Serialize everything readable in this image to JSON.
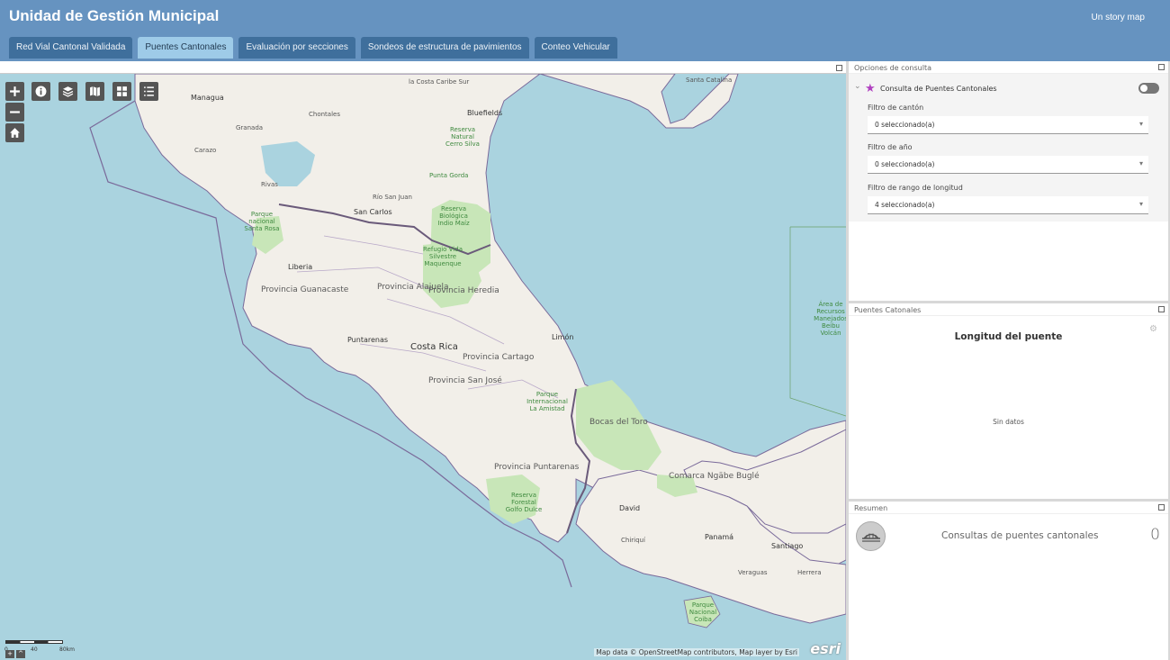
{
  "header": {
    "title": "Unidad de Gestión Municipal",
    "link": "Un story map"
  },
  "tabs": [
    {
      "label": "Red Vial Cantonal Validada",
      "active": false
    },
    {
      "label": "Puentes Cantonales",
      "active": true
    },
    {
      "label": "Evaluación por secciones",
      "active": false
    },
    {
      "label": "Sondeos de estructura de pavimientos",
      "active": false
    },
    {
      "label": "Conteo Vehicular",
      "active": false
    }
  ],
  "map": {
    "controls": [
      "zoom-in-icon",
      "zoom-out-icon",
      "home-icon",
      "info-icon",
      "layers-icon",
      "basemap-icon",
      "grid-icon",
      "legend-list-icon"
    ],
    "labels": {
      "managua": "Managua",
      "granada": "Granada",
      "carazo": "Carazo",
      "rivas": "Rivas",
      "chontales": "Chontales",
      "costa_caribe": "la Costa Caribe Sur",
      "bluefields": "Bluefields",
      "santa_catalina": "Santa Catalina",
      "reserva_cerro_silva": "Reserva Natural Cerro Silva",
      "punta_gorda": "Punta Gorda",
      "rio_san_juan": "Río San Juan",
      "san_carlos": "San Carlos",
      "reserva_indio_maiz": "Reserva Biológica Indio Maíz",
      "parque_santa_rosa": "Parque nacional Santa Rosa",
      "liberia": "Liberia",
      "refugio": "Refugio Vida Silvestre Maquenque",
      "guanacaste": "Provincia Guanacaste",
      "alajuela": "Provincia Alajuela",
      "heredia": "Provincia Heredia",
      "area_recursos": "Área de Recursos Manejados Beibu Volcán",
      "puntarenas_city": "Puntarenas",
      "costa_rica": "Costa Rica",
      "limon": "Limón",
      "cartago": "Provincia Cartago",
      "san_jose": "Provincia San José",
      "la_amistad": "Parque Internacional La Amistad",
      "bocas": "Bocas del Toro",
      "ngabe": "Comarca Ngäbe Buglé",
      "prov_puntarenas": "Provincia Puntarenas",
      "golfo_dulce": "Reserva Forestal Golfo Dulce",
      "david": "David",
      "chiriqui": "Chiriquí",
      "panama": "Panamá",
      "santiago": "Santiago",
      "veraguas": "Veraguas",
      "herrera": "Herrera",
      "coiba": "Parque Nacional Coiba"
    },
    "scale": {
      "zero": "0",
      "mid": "40",
      "end": "80km"
    },
    "attribution": "Map data © OpenStreetMap contributors, Map layer by Esri",
    "logo": "esri"
  },
  "query_panel": {
    "header": "Opciones de consulta",
    "title": "Consulta de Puentes Cantonales",
    "filters": [
      {
        "label": "Filtro de cantón",
        "value": "0 seleccionado(a)"
      },
      {
        "label": "Filtro de año",
        "value": "0 seleccionado(a)"
      },
      {
        "label": "Filtro de rango de longitud",
        "value": "4 seleccionado(a)"
      }
    ]
  },
  "chart_panel": {
    "header": "Puentes Catonales",
    "title": "Longitud del puente",
    "empty_text": "Sin datos"
  },
  "summary_panel": {
    "header": "Resumen",
    "label": "Consultas de puentes cantonales",
    "count": "0"
  },
  "colors": {
    "header_bg": "#6693c0",
    "tab_bg": "#3f6f9c",
    "tab_active": "#9ecbe8",
    "water": "#aad3df",
    "land": "#f2efe9",
    "park": "#c8e6b8"
  }
}
